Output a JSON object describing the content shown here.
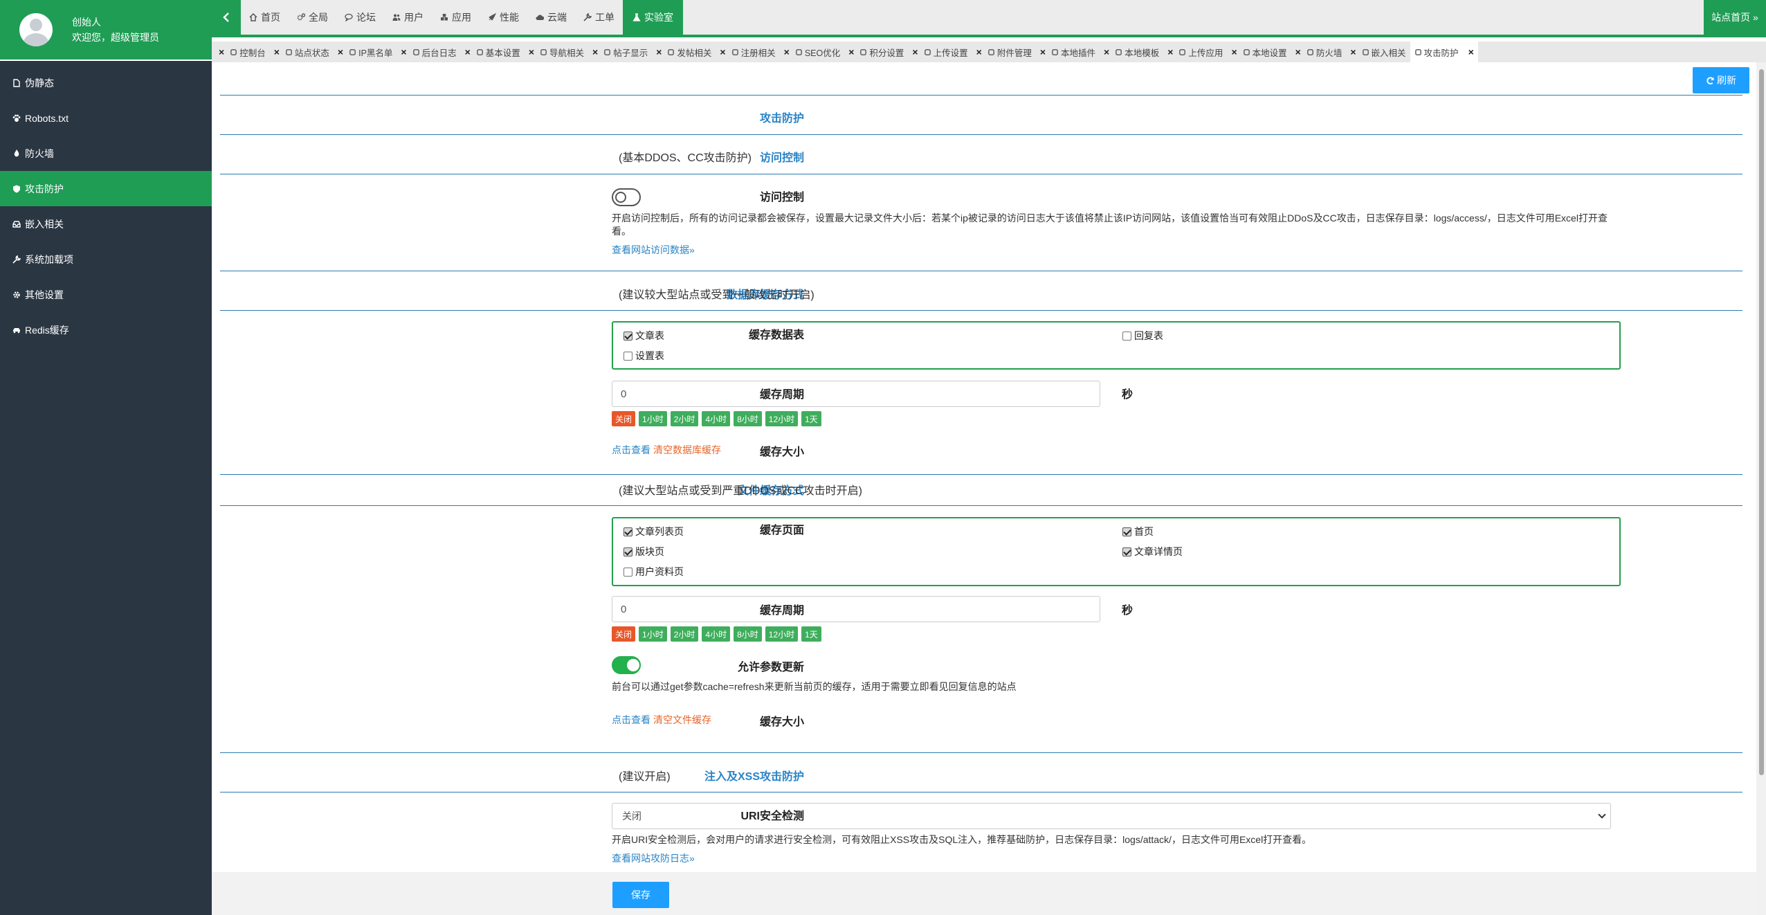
{
  "user": {
    "name": "创始人",
    "welcome": "欢迎您，超级管理员"
  },
  "sidebar": {
    "items": [
      {
        "label": "伪静态",
        "icon": "file-icon"
      },
      {
        "label": "Robots.txt",
        "icon": "paw-icon"
      },
      {
        "label": "防火墙",
        "icon": "fire-icon"
      },
      {
        "label": "攻击防护",
        "icon": "shield-icon"
      },
      {
        "label": "嵌入相关",
        "icon": "inbox-icon"
      },
      {
        "label": "系统加载项",
        "icon": "wrench-icon"
      },
      {
        "label": "其他设置",
        "icon": "gear-icon"
      },
      {
        "label": "Redis缓存",
        "icon": "car-icon"
      }
    ]
  },
  "topnav": {
    "items": [
      {
        "label": "首页",
        "icon": "home-icon"
      },
      {
        "label": "全局",
        "icon": "cogs-icon"
      },
      {
        "label": "论坛",
        "icon": "comments-icon"
      },
      {
        "label": "用户",
        "icon": "users-icon"
      },
      {
        "label": "应用",
        "icon": "cubes-icon"
      },
      {
        "label": "性能",
        "icon": "rocket-icon"
      },
      {
        "label": "云端",
        "icon": "cloud-icon"
      },
      {
        "label": "工单",
        "icon": "wrench-icon"
      },
      {
        "label": "实验室",
        "icon": "flask-icon"
      }
    ],
    "home_link": "站点首页 »"
  },
  "tabs": [
    {
      "label": "控制台",
      "icon": "dashboard-icon"
    },
    {
      "label": "站点状态",
      "icon": "globe-icon"
    },
    {
      "label": "IP黑名单",
      "icon": "ban-icon"
    },
    {
      "label": "后台日志",
      "icon": "calendar-icon"
    },
    {
      "label": "基本设置",
      "icon": "gear-icon"
    },
    {
      "label": "导航相关",
      "icon": "list-icon"
    },
    {
      "label": "帖子显示",
      "icon": "monitor-icon"
    },
    {
      "label": "发帖相关",
      "icon": "edit-icon"
    },
    {
      "label": "注册相关",
      "icon": "signin-icon"
    },
    {
      "label": "SEO优化",
      "icon": "paw-icon"
    },
    {
      "label": "积分设置",
      "icon": "money-icon"
    },
    {
      "label": "上传设置",
      "icon": "upload-icon"
    },
    {
      "label": "附件管理",
      "icon": "folder-icon"
    },
    {
      "label": "本地插件",
      "icon": "plug-icon"
    },
    {
      "label": "本地模板",
      "icon": "puzzle-icon"
    },
    {
      "label": "上传应用",
      "icon": "upload-icon"
    },
    {
      "label": "本地设置",
      "icon": "cloud-icon"
    },
    {
      "label": "防火墙",
      "icon": "fire-icon"
    },
    {
      "label": "嵌入相关",
      "icon": "inbox-icon"
    },
    {
      "label": "攻击防护",
      "icon": "shield-icon"
    }
  ],
  "content": {
    "refresh": "刷新",
    "page_title": "攻击防护",
    "access": {
      "title": "访问控制",
      "note": "(基本DDOS、CC攻击防护)",
      "label": "访问控制",
      "desc": "开启访问控制后，所有的访问记录都会被保存，设置最大记录文件大小后：若某个ip被记录的访问日志大于该值将禁止该IP访问网站，该值设置恰当可有效阻止DDoS及CC攻击，日志保存目录：logs/access/，日志文件可用Excel打开查看。",
      "link": "查看网站访问数据»"
    },
    "db": {
      "title": "数据库缓存方式",
      "note": "(建议较大型站点或受到一般攻击时开启)",
      "tables_label": "缓存数据表",
      "tables": [
        {
          "label": "文章表",
          "checked": true
        },
        {
          "label": "回复表",
          "checked": false
        },
        {
          "label": "设置表",
          "checked": false
        }
      ],
      "period_label": "缓存周期",
      "period_value": "0",
      "unit": "秒",
      "size_label": "缓存大小",
      "view": "点击查看",
      "clear": "清空数据库缓存"
    },
    "presets": [
      "关闭",
      "1小时",
      "2小时",
      "4小时",
      "8小时",
      "12小时",
      "1天"
    ],
    "file": {
      "title": "文件缓存方式",
      "note": "(建议大型站点或受到严重DDOS或CC攻击时开启)",
      "pages_label": "缓存页面",
      "pages": [
        {
          "label": "文章列表页",
          "checked": true
        },
        {
          "label": "首页",
          "checked": true
        },
        {
          "label": "版块页",
          "checked": true
        },
        {
          "label": "文章详情页",
          "checked": true
        },
        {
          "label": "用户资料页",
          "checked": false
        }
      ],
      "period_label": "缓存周期",
      "period_value": "0",
      "unit": "秒",
      "allow_label": "允许参数更新",
      "allow_desc": "前台可以通过get参数cache=refresh来更新当前页的缓存，适用于需要立即看见回复信息的站点",
      "size_label": "缓存大小",
      "view": "点击查看",
      "clear": "清空文件缓存"
    },
    "xss": {
      "title": "注入及XSS攻击防护",
      "note": "(建议开启)",
      "uri_label": "URI安全检测",
      "uri_value": "关闭",
      "desc": "开启URI安全检测后，会对用户的请求进行安全检测，可有效阻止XSS攻击及SQL注入，推荐基础防护，日志保存目录：logs/attack/，日志文件可用Excel打开查看。",
      "link": "查看网站攻防日志»"
    },
    "save": "保存"
  }
}
